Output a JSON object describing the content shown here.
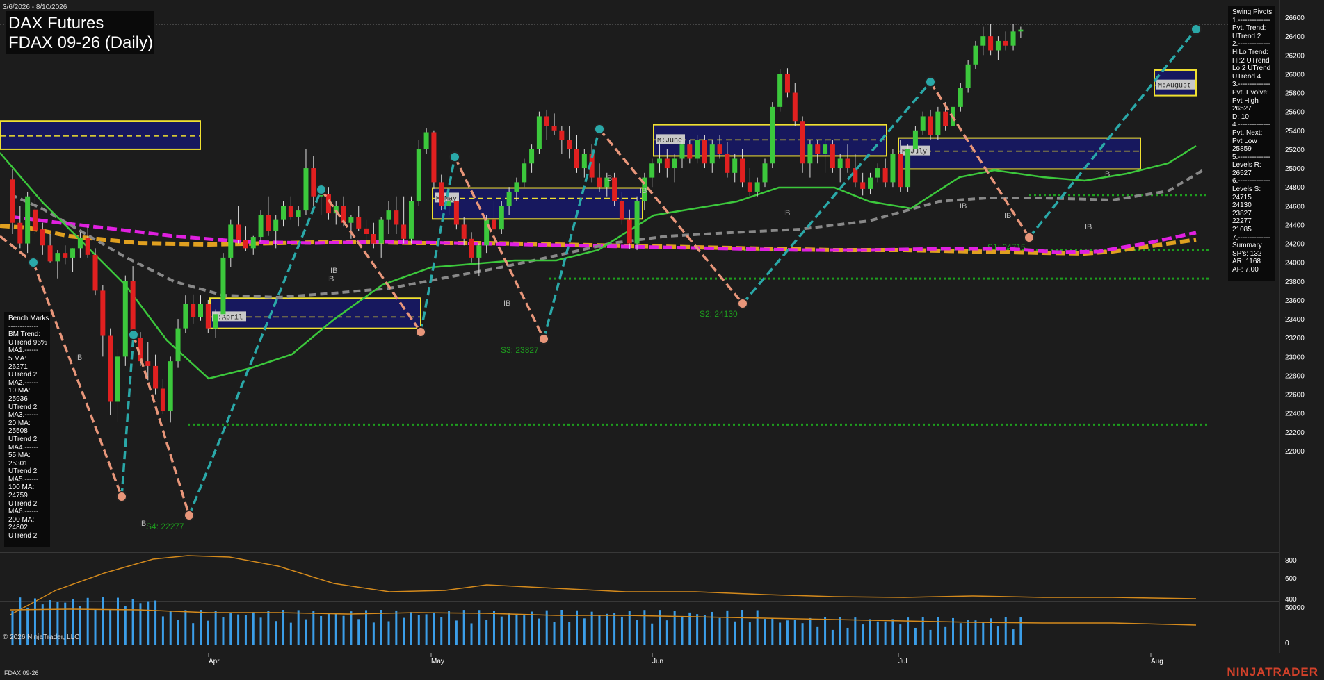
{
  "header": {
    "title": "DAX Futures",
    "subtitle": "FDAX 09-26 (Daily)",
    "date_range": "3/6/2026 - 8/10/2026"
  },
  "footer": {
    "copyright": "© 2026 NinjaTrader, LLC",
    "instrument": "FDAX 09-26",
    "brand": "NINJATRADER"
  },
  "swing_pivots_panel": {
    "lines": [
      "Swing Pivots",
      "1.--------------",
      "Pvt. Trend:",
      "UTrend 2",
      "2.--------------",
      "HiLo Trend:",
      "Hi:2 UTrend",
      "Lo:2 UTrend",
      "UTrend 4",
      "3.--------------",
      "Pvt. Evolve:",
      "Pvt High",
      "26527",
      "D: 10",
      "4.--------------",
      "Pvt. Next:",
      "Pvt Low",
      "25859",
      "5.--------------",
      "Levels R:",
      "26527",
      "6.--------------",
      "Levels S:",
      "24715",
      "24130",
      "23827",
      "22277",
      "21085",
      "7.--------------",
      "Summary",
      "SP's: 132",
      "AR: 1168",
      "AF: 7.00"
    ]
  },
  "benchmarks_panel": {
    "lines": [
      "Bench Marks",
      "-------------",
      "BM Trend:",
      "UTrend 96%",
      "MA1.------",
      "5 MA:",
      "26271",
      "UTrend 2",
      "MA2.------",
      "10 MA:",
      "25936",
      "UTrend 2",
      "MA3.------",
      "20 MA:",
      "25508",
      "UTrend 2",
      "MA4.------",
      "55 MA:",
      "25301",
      "UTrend 2",
      "MA5.------",
      "100 MA:",
      "24759",
      "UTrend 2",
      "MA6.------",
      "200 MA:",
      "24802",
      "UTrend 2"
    ]
  },
  "colors": {
    "background": "#1c1c1c",
    "up_candle": "#3cc83c",
    "down_candle": "#e02020",
    "swing_up": "#2aa8a8",
    "swing_down": "#e8967a",
    "value_area": "#17185e",
    "value_area_border": "#f0e030",
    "ma5": "#3cc83c",
    "ma55": "#888888",
    "ma100": "#e0a020",
    "ma200": "#e020e0",
    "support": "#1e9e1e"
  },
  "chart_data": [
    {
      "type": "candlestick",
      "panel": "price",
      "y_axis": {
        "ticks": [
          22000,
          22200,
          22400,
          22600,
          22800,
          23000,
          23200,
          23400,
          23600,
          23800,
          24000,
          24200,
          24400,
          24600,
          24800,
          25000,
          25200,
          25400,
          25600,
          25800,
          26000,
          26200,
          26400,
          26600
        ],
        "ylim": [
          21940,
          26680
        ]
      },
      "x_axis": {
        "labels": [
          "Apr",
          "May",
          "Jun",
          "Jul",
          "Aug"
        ]
      },
      "candles": [
        {
          "o": 24880,
          "h": 24990,
          "l": 24300,
          "c": 24420
        },
        {
          "o": 24420,
          "h": 24600,
          "l": 24150,
          "c": 24200
        },
        {
          "o": 24200,
          "h": 24750,
          "l": 24100,
          "c": 24700
        },
        {
          "o": 24560,
          "h": 24710,
          "l": 24300,
          "c": 24340
        },
        {
          "o": 24350,
          "h": 24420,
          "l": 24080,
          "c": 24180
        },
        {
          "o": 24180,
          "h": 24300,
          "l": 24000,
          "c": 24010
        },
        {
          "o": 24010,
          "h": 24130,
          "l": 23830,
          "c": 24100
        },
        {
          "o": 24100,
          "h": 24180,
          "l": 23980,
          "c": 24050
        },
        {
          "o": 24050,
          "h": 24150,
          "l": 23900,
          "c": 24150
        },
        {
          "o": 24150,
          "h": 24320,
          "l": 24050,
          "c": 24260
        },
        {
          "o": 24260,
          "h": 24380,
          "l": 24050,
          "c": 24080
        },
        {
          "o": 24080,
          "h": 24150,
          "l": 23650,
          "c": 23700
        },
        {
          "o": 23700,
          "h": 23760,
          "l": 23000,
          "c": 23220
        },
        {
          "o": 23220,
          "h": 23300,
          "l": 22380,
          "c": 22520
        },
        {
          "o": 22520,
          "h": 23080,
          "l": 22300,
          "c": 23000
        },
        {
          "o": 23000,
          "h": 23860,
          "l": 22900,
          "c": 23800
        },
        {
          "o": 23800,
          "h": 23960,
          "l": 23150,
          "c": 23200
        },
        {
          "o": 23200,
          "h": 23260,
          "l": 22900,
          "c": 22950
        },
        {
          "o": 22950,
          "h": 23150,
          "l": 22750,
          "c": 22900
        },
        {
          "o": 22900,
          "h": 23020,
          "l": 22600,
          "c": 22660
        },
        {
          "o": 22660,
          "h": 22760,
          "l": 22390,
          "c": 22420
        },
        {
          "o": 22420,
          "h": 23000,
          "l": 22300,
          "c": 22950
        },
        {
          "o": 22950,
          "h": 23400,
          "l": 22880,
          "c": 23300
        },
        {
          "o": 23300,
          "h": 23650,
          "l": 23250,
          "c": 23560
        },
        {
          "o": 23560,
          "h": 23660,
          "l": 23350,
          "c": 23420
        },
        {
          "o": 23420,
          "h": 23650,
          "l": 23380,
          "c": 23560
        },
        {
          "o": 23560,
          "h": 23600,
          "l": 23250,
          "c": 23300
        },
        {
          "o": 23300,
          "h": 23500,
          "l": 23200,
          "c": 23450
        },
        {
          "o": 23450,
          "h": 24100,
          "l": 23400,
          "c": 24050
        },
        {
          "o": 24050,
          "h": 24450,
          "l": 23950,
          "c": 24400
        },
        {
          "o": 24400,
          "h": 24600,
          "l": 24200,
          "c": 24240
        },
        {
          "o": 24240,
          "h": 24380,
          "l": 24120,
          "c": 24150
        },
        {
          "o": 24150,
          "h": 24280,
          "l": 24080,
          "c": 24270
        },
        {
          "o": 24270,
          "h": 24550,
          "l": 24220,
          "c": 24500
        },
        {
          "o": 24500,
          "h": 24700,
          "l": 24280,
          "c": 24330
        },
        {
          "o": 24330,
          "h": 24500,
          "l": 24150,
          "c": 24450
        },
        {
          "o": 24450,
          "h": 24650,
          "l": 24380,
          "c": 24600
        },
        {
          "o": 24600,
          "h": 24700,
          "l": 24450,
          "c": 24480
        },
        {
          "o": 24480,
          "h": 24600,
          "l": 24380,
          "c": 24550
        },
        {
          "o": 24550,
          "h": 25200,
          "l": 24500,
          "c": 25000
        },
        {
          "o": 25000,
          "h": 25130,
          "l": 24600,
          "c": 24700
        },
        {
          "o": 24700,
          "h": 24820,
          "l": 24500,
          "c": 24720
        },
        {
          "o": 24720,
          "h": 24800,
          "l": 24450,
          "c": 24520
        },
        {
          "o": 24520,
          "h": 24650,
          "l": 24400,
          "c": 24600
        },
        {
          "o": 24600,
          "h": 24700,
          "l": 24380,
          "c": 24420
        },
        {
          "o": 24420,
          "h": 24500,
          "l": 24250,
          "c": 24480
        },
        {
          "o": 24480,
          "h": 24600,
          "l": 24330,
          "c": 24360
        },
        {
          "o": 24360,
          "h": 24450,
          "l": 24200,
          "c": 24300
        },
        {
          "o": 24300,
          "h": 24420,
          "l": 24150,
          "c": 24200
        },
        {
          "o": 24200,
          "h": 24480,
          "l": 24050,
          "c": 24450
        },
        {
          "o": 24450,
          "h": 24650,
          "l": 24300,
          "c": 24550
        },
        {
          "o": 24550,
          "h": 24700,
          "l": 24300,
          "c": 24400
        },
        {
          "o": 24400,
          "h": 24700,
          "l": 24200,
          "c": 24250
        },
        {
          "o": 24250,
          "h": 24700,
          "l": 24200,
          "c": 24650
        },
        {
          "o": 24650,
          "h": 25300,
          "l": 24600,
          "c": 25200
        },
        {
          "o": 25200,
          "h": 25420,
          "l": 25150,
          "c": 25380
        },
        {
          "o": 25380,
          "h": 25400,
          "l": 24780,
          "c": 24850
        },
        {
          "o": 24850,
          "h": 24930,
          "l": 24550,
          "c": 24600
        },
        {
          "o": 24600,
          "h": 24700,
          "l": 24500,
          "c": 24650
        },
        {
          "o": 24650,
          "h": 24680,
          "l": 24350,
          "c": 24400
        },
        {
          "o": 24400,
          "h": 24480,
          "l": 24180,
          "c": 24250
        },
        {
          "o": 24250,
          "h": 24320,
          "l": 24000,
          "c": 24050
        },
        {
          "o": 24050,
          "h": 24200,
          "l": 23850,
          "c": 24180
        },
        {
          "o": 24180,
          "h": 24500,
          "l": 24100,
          "c": 24450
        },
        {
          "o": 24450,
          "h": 24650,
          "l": 24300,
          "c": 24350
        },
        {
          "o": 24350,
          "h": 24650,
          "l": 24300,
          "c": 24600
        },
        {
          "o": 24600,
          "h": 24800,
          "l": 24500,
          "c": 24750
        },
        {
          "o": 24750,
          "h": 24900,
          "l": 24650,
          "c": 24850
        },
        {
          "o": 24850,
          "h": 25100,
          "l": 24800,
          "c": 25050
        },
        {
          "o": 25050,
          "h": 25250,
          "l": 24950,
          "c": 25200
        },
        {
          "o": 25200,
          "h": 25600,
          "l": 25150,
          "c": 25550
        },
        {
          "o": 25550,
          "h": 25620,
          "l": 25300,
          "c": 25450
        },
        {
          "o": 25450,
          "h": 25580,
          "l": 25350,
          "c": 25400
        },
        {
          "o": 25400,
          "h": 25450,
          "l": 25150,
          "c": 25300
        },
        {
          "o": 25300,
          "h": 25450,
          "l": 25100,
          "c": 25200
        },
        {
          "o": 25200,
          "h": 25350,
          "l": 24950,
          "c": 25000
        },
        {
          "o": 25000,
          "h": 25200,
          "l": 24900,
          "c": 25150
        },
        {
          "o": 25150,
          "h": 25250,
          "l": 24850,
          "c": 24900
        },
        {
          "o": 24900,
          "h": 25050,
          "l": 24750,
          "c": 24800
        },
        {
          "o": 24800,
          "h": 24950,
          "l": 24700,
          "c": 24900
        },
        {
          "o": 24900,
          "h": 24950,
          "l": 24600,
          "c": 24650
        },
        {
          "o": 24650,
          "h": 24750,
          "l": 24400,
          "c": 24450
        },
        {
          "o": 24450,
          "h": 24560,
          "l": 24140,
          "c": 24200
        },
        {
          "o": 24200,
          "h": 24700,
          "l": 24130,
          "c": 24650
        },
        {
          "o": 24650,
          "h": 24950,
          "l": 24550,
          "c": 24900
        },
        {
          "o": 24900,
          "h": 25100,
          "l": 24800,
          "c": 25050
        },
        {
          "o": 25050,
          "h": 25250,
          "l": 24950,
          "c": 25100
        },
        {
          "o": 25100,
          "h": 25200,
          "l": 24900,
          "c": 25000
        },
        {
          "o": 25000,
          "h": 25150,
          "l": 24850,
          "c": 25100
        },
        {
          "o": 25100,
          "h": 25300,
          "l": 25000,
          "c": 25250
        },
        {
          "o": 25250,
          "h": 25300,
          "l": 25050,
          "c": 25100
        },
        {
          "o": 25100,
          "h": 25350,
          "l": 25050,
          "c": 25300
        },
        {
          "o": 25300,
          "h": 25350,
          "l": 25000,
          "c": 25050
        },
        {
          "o": 25050,
          "h": 25300,
          "l": 24950,
          "c": 25250
        },
        {
          "o": 25250,
          "h": 25350,
          "l": 25100,
          "c": 25150
        },
        {
          "o": 25150,
          "h": 25280,
          "l": 24900,
          "c": 24950
        },
        {
          "o": 24950,
          "h": 25150,
          "l": 24850,
          "c": 25100
        },
        {
          "o": 25100,
          "h": 25200,
          "l": 24800,
          "c": 24850
        },
        {
          "o": 24850,
          "h": 25000,
          "l": 24700,
          "c": 24750
        },
        {
          "o": 24750,
          "h": 24900,
          "l": 24700,
          "c": 24850
        },
        {
          "o": 24850,
          "h": 25100,
          "l": 24800,
          "c": 25050
        },
        {
          "o": 25050,
          "h": 25700,
          "l": 25000,
          "c": 25650
        },
        {
          "o": 25650,
          "h": 26050,
          "l": 25600,
          "c": 26000
        },
        {
          "o": 26000,
          "h": 26060,
          "l": 25750,
          "c": 25800
        },
        {
          "o": 25800,
          "h": 25900,
          "l": 25450,
          "c": 25500
        },
        {
          "o": 25500,
          "h": 25550,
          "l": 24950,
          "c": 25050
        },
        {
          "o": 25050,
          "h": 25300,
          "l": 24900,
          "c": 25250
        },
        {
          "o": 25250,
          "h": 25300,
          "l": 25050,
          "c": 25150
        },
        {
          "o": 25150,
          "h": 25300,
          "l": 24950,
          "c": 25250
        },
        {
          "o": 25250,
          "h": 25300,
          "l": 24950,
          "c": 25000
        },
        {
          "o": 25000,
          "h": 25150,
          "l": 24850,
          "c": 25100
        },
        {
          "o": 25100,
          "h": 25250,
          "l": 24950,
          "c": 25000
        },
        {
          "o": 25000,
          "h": 25150,
          "l": 24800,
          "c": 24850
        },
        {
          "o": 24850,
          "h": 24950,
          "l": 24710,
          "c": 24780
        },
        {
          "o": 24780,
          "h": 24950,
          "l": 24720,
          "c": 24900
        },
        {
          "o": 24900,
          "h": 25050,
          "l": 24850,
          "c": 25000
        },
        {
          "o": 25000,
          "h": 25100,
          "l": 24800,
          "c": 24850
        },
        {
          "o": 24850,
          "h": 25200,
          "l": 24800,
          "c": 25150
        },
        {
          "o": 25150,
          "h": 25300,
          "l": 24750,
          "c": 24800
        },
        {
          "o": 24800,
          "h": 25250,
          "l": 24750,
          "c": 25200
        },
        {
          "o": 25200,
          "h": 25450,
          "l": 25150,
          "c": 25400
        },
        {
          "o": 25400,
          "h": 25600,
          "l": 25350,
          "c": 25550
        },
        {
          "o": 25550,
          "h": 25620,
          "l": 25300,
          "c": 25350
        },
        {
          "o": 25350,
          "h": 25650,
          "l": 25300,
          "c": 25600
        },
        {
          "o": 25600,
          "h": 25700,
          "l": 25400,
          "c": 25450
        },
        {
          "o": 25450,
          "h": 25700,
          "l": 25400,
          "c": 25650
        },
        {
          "o": 25650,
          "h": 25900,
          "l": 25600,
          "c": 25850
        },
        {
          "o": 25850,
          "h": 26150,
          "l": 25800,
          "c": 26100
        },
        {
          "o": 26100,
          "h": 26350,
          "l": 26050,
          "c": 26300
        },
        {
          "o": 26300,
          "h": 26500,
          "l": 26200,
          "c": 26400
        },
        {
          "o": 26400,
          "h": 26527,
          "l": 26200,
          "c": 26250
        },
        {
          "o": 26250,
          "h": 26400,
          "l": 26150,
          "c": 26350
        },
        {
          "o": 26350,
          "h": 26450,
          "l": 26250,
          "c": 26300
        },
        {
          "o": 26300,
          "h": 26527,
          "l": 26250,
          "c": 26450
        },
        {
          "o": 26450,
          "h": 26500,
          "l": 26380,
          "c": 26470
        }
      ],
      "swing_labels": [
        {
          "text": "S4: 22277",
          "price": 22277
        },
        {
          "text": "S3: 23827",
          "price": 23827
        },
        {
          "text": "S2: 24130",
          "price": 24130
        },
        {
          "text": "S1: 24715",
          "price": 24715
        }
      ],
      "value_areas": [
        {
          "label": "M:April",
          "low": 23300,
          "high": 23620,
          "mid": 23420
        },
        {
          "label": "M:May",
          "low": 24460,
          "high": 24790,
          "mid": 24680
        },
        {
          "label": "M:June",
          "low": 25130,
          "high": 25460,
          "mid": 25300
        },
        {
          "label": "M:July",
          "low": 24990,
          "high": 25320,
          "mid": 25180
        },
        {
          "label": "M:August",
          "low": 25770,
          "high": 26040,
          "mid": 25880
        },
        {
          "label": "",
          "low": 25200,
          "high": 25500,
          "mid": 25340
        }
      ],
      "ib_label": "IB",
      "moving_averages": [
        {
          "name": "5 MA",
          "value": 26271
        },
        {
          "name": "10 MA",
          "value": 25936
        },
        {
          "name": "20 MA",
          "value": 25508
        },
        {
          "name": "55 MA",
          "value": 25301
        },
        {
          "name": "100 MA",
          "value": 24759
        },
        {
          "name": "200 MA",
          "value": 24802
        }
      ]
    },
    {
      "type": "line",
      "panel": "oscillator",
      "y_axis": {
        "ticks": [
          400,
          600,
          800
        ]
      },
      "series": []
    },
    {
      "type": "bar",
      "panel": "volume",
      "y_axis": {
        "ticks": [
          0,
          50000
        ]
      },
      "series": []
    }
  ]
}
